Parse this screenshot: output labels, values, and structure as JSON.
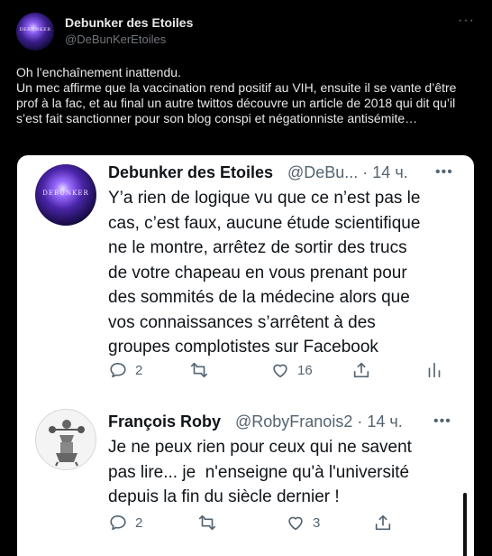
{
  "author": {
    "name": "Debunker des Etoiles",
    "handle": "@DeBunKerEtoiles",
    "avatar_text": "DEBUNKER"
  },
  "tweet": {
    "text": "Oh l’enchaînement inattendu.\nUn mec affirme que la vaccination rend positif au VIH, ensuite il se vante d’être prof à la fac, et au final un autre twittos découvre un article de 2018 qui dit qu’il s’est fait sanctionner pour son blog conspi et négationniste antisémite…"
  },
  "screenshot": {
    "replies": [
      {
        "name": "Debunker des Etoiles",
        "handle_time": "@DeBu... · 14 ч.",
        "avatar_text": "DEBUNKER",
        "text": "Y’a rien de logique vu que ce n’est pas le\ncas, c’est faux, aucune étude scientifique\nne le montre, arrêtez de sortir des trucs\nde votre chapeau en vous prenant pour\ndes sommités de la médecine alors que\nvos connaissances s’arrêtent à des\ngroupes complotistes sur Facebook",
        "replies_count": "2",
        "likes_count": "16"
      },
      {
        "name": "François Roby",
        "handle_time": "@RobyFranois2 · 14 ч.",
        "text": "Je ne peux rien pour ceux qui ne savent\npas lire... je  n'enseigne qu'à l'université\ndepuis la fin du siècle dernier !",
        "replies_count": "2",
        "likes_count": "3"
      }
    ]
  },
  "icons": {
    "more": "more-horizontal-icon",
    "reply": "reply-icon",
    "retweet": "retweet-icon",
    "like": "heart-icon",
    "share": "share-icon",
    "views": "views-icon"
  },
  "colors": {
    "background": "#000000",
    "text_primary": "#e7e9ea",
    "text_secondary": "#71767b",
    "card_background": "#ffffff",
    "card_text": "#0f1419",
    "card_secondary": "#536471"
  }
}
